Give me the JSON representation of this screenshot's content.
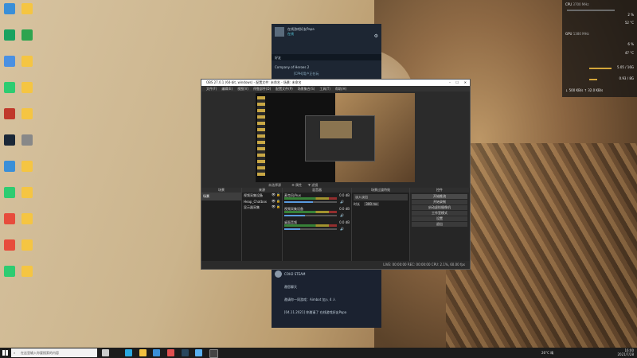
{
  "desktop_icons": [
    {
      "label": "",
      "color": "#3a8fd8"
    },
    {
      "label": "",
      "color": "#f5c542"
    },
    {
      "label": "",
      "color": "#1aa260"
    },
    {
      "label": "",
      "color": "#2ea44f"
    },
    {
      "label": "",
      "color": "#4a90e2"
    },
    {
      "label": "",
      "color": "#f5c542"
    },
    {
      "label": "",
      "color": "#2ecc71"
    },
    {
      "label": "",
      "color": "#f5c542"
    },
    {
      "label": "",
      "color": "#c0392b"
    },
    {
      "label": "",
      "color": "#f5c542"
    },
    {
      "label": "",
      "color": "#1b2838"
    },
    {
      "label": "",
      "color": "#888"
    },
    {
      "label": "",
      "color": "#3a8fd8"
    },
    {
      "label": "",
      "color": "#f5c542"
    },
    {
      "label": "",
      "color": "#2ecc71"
    },
    {
      "label": "",
      "color": "#f5c542"
    },
    {
      "label": "",
      "color": "#e74c3c"
    },
    {
      "label": "",
      "color": "#f5c542"
    },
    {
      "label": "",
      "color": "#e74c3c"
    },
    {
      "label": "",
      "color": "#f5c542"
    },
    {
      "label": "",
      "color": "#2ecc71"
    },
    {
      "label": "",
      "color": "#f5c542"
    }
  ],
  "monitor": {
    "cpu_label": "CPU",
    "cpu_freq": "3700 MHz",
    "cpu_usage": "2 %",
    "cpu_temp": "52 °C",
    "gpu_label": "GPU",
    "gpu_freq": "1380 MHz",
    "gpu_usage": "6 %",
    "gpu_temp": "47 °C",
    "ram": "5.05 / 16G",
    "vram": "0.93 / 8G",
    "net_down": "500 KB/s",
    "net_up": "32.0 KB/s"
  },
  "steam": {
    "friend_name": "在线游戏好友Papa",
    "status": "在线",
    "search_placeholder": "好友",
    "game_group": "Company of Heroes 2",
    "game_friend": "[CPH]用户正在玩",
    "bottom_group": "COH2 STEAM",
    "chat1": "邀您聊天",
    "chat2": "邀请你一同游戏：Aimbot 加入 4 人",
    "chat3": "[04.11.2021] 你邀请了 在线游戏好友Papa"
  },
  "obs": {
    "title": "OBS 27.0.1 (64-bit, windows) - 配置文件: 未命名 - 场景: 未命名",
    "menus": [
      "文件(F)",
      "编辑(E)",
      "视图(V)",
      "停靠部件(D)",
      "配置文件(P)",
      "场景集合(S)",
      "工具(T)",
      "帮助(H)"
    ],
    "no_source": "未选择源",
    "properties": "属性",
    "filters": "滤镜",
    "docks": {
      "scenes": "场景",
      "sources": "来源",
      "mixer": "混音器",
      "transitions": "场景过渡特效",
      "controls": "控件"
    },
    "scene_item": "场景",
    "sources": [
      "视频采集设备",
      "Heap_Chatbox",
      "显示器采集"
    ],
    "mixer": [
      {
        "name": "麦克风/Aux",
        "db": "0.0 dB",
        "level": 0.55
      },
      {
        "name": "视频采集设备",
        "db": "0.0 dB",
        "level": 0.4
      },
      {
        "name": "桌面音频",
        "db": "0.0 dB",
        "level": 0.3
      }
    ],
    "transition_type": "淡入淡出",
    "duration_label": "时长",
    "duration": "300 ms",
    "controls": [
      "开始推流",
      "开始录制",
      "启动虚拟摄像机",
      "工作室模式",
      "设置",
      "退出"
    ],
    "status": "LIVE: 00:00:00  REC: 00:00:00  CPU: 2.1%, 60.00 fps"
  },
  "taskbar": {
    "search_placeholder": "在这里输入你要搜索的内容",
    "weather": "26°C 晴",
    "time": "16:00",
    "date": "2021/7/28"
  }
}
